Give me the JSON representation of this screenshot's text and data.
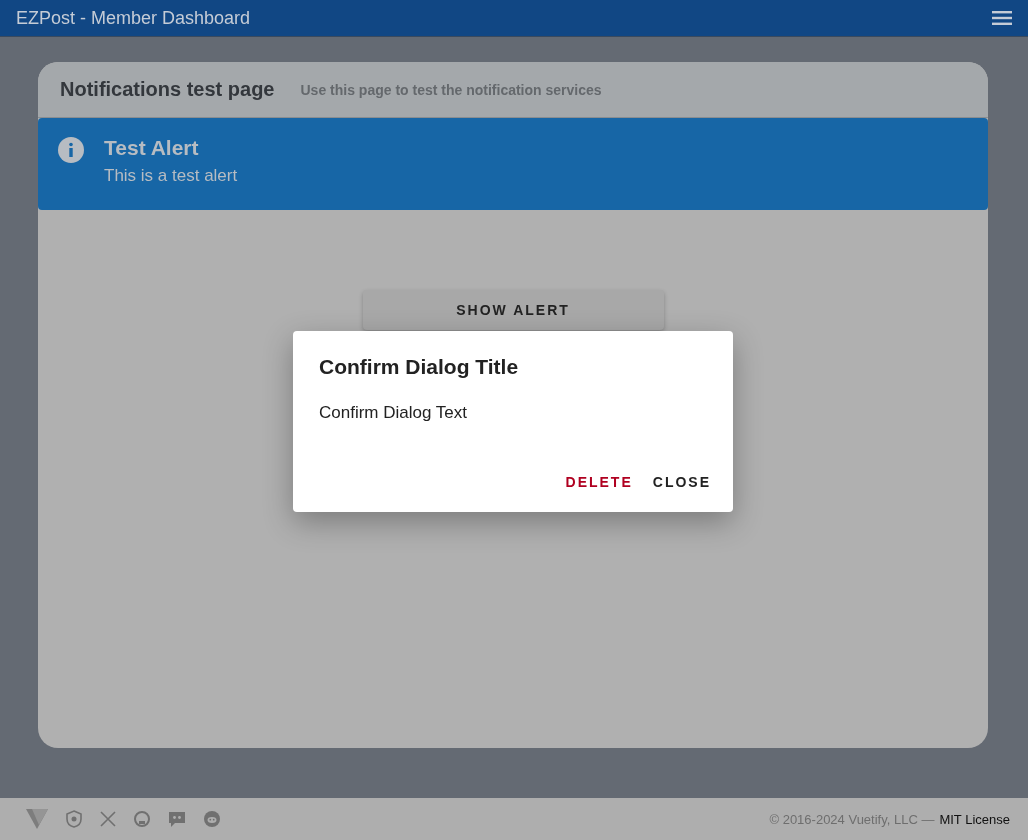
{
  "app_bar": {
    "title": "EZPost - Member Dashboard"
  },
  "card": {
    "title": "Notifications test page",
    "subtitle": "Use this page to test the notification services"
  },
  "alert": {
    "title": "Test Alert",
    "text": "This is a test alert"
  },
  "show_button": {
    "label": "SHOW ALERT"
  },
  "dialog": {
    "title": "Confirm Dialog Title",
    "text": "Confirm Dialog Text",
    "buttons": [
      {
        "label": "DELETE",
        "kind": "danger"
      },
      {
        "label": "CLOSE",
        "kind": "plain"
      }
    ]
  },
  "footer": {
    "copyright": "© 2016-2024 Vuetify, LLC —",
    "link": "MIT License"
  }
}
